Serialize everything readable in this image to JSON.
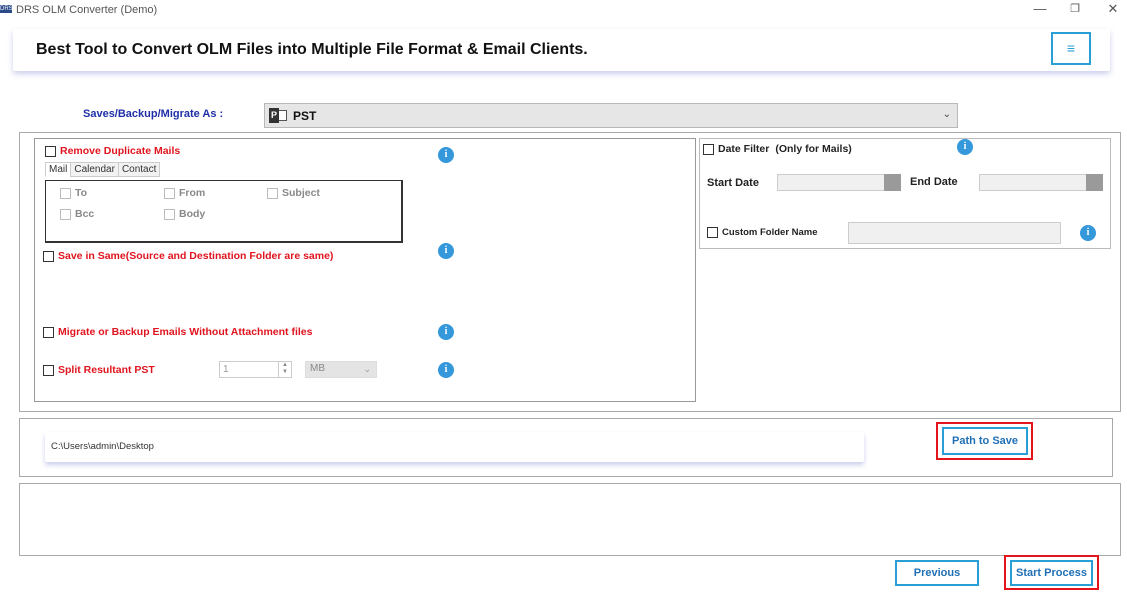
{
  "window": {
    "icon_text": "DRS",
    "title": "DRS OLM Converter (Demo)",
    "controls": {
      "minimize": "—",
      "restore": "❐",
      "close": "✕"
    }
  },
  "banner": {
    "heading": "Best Tool to Convert OLM Files into Multiple File Format & Email Clients.",
    "menu_icon": "≡"
  },
  "format": {
    "label": "Saves/Backup/Migrate As :",
    "icon_letter": "P",
    "selected": "PST",
    "arrow": "⌄"
  },
  "options": {
    "remove_duplicates": "Remove Duplicate Mails",
    "tabs": [
      "Mail",
      "Calendar",
      "Contact"
    ],
    "criteria": {
      "to": "To",
      "from": "From",
      "subject": "Subject",
      "bcc": "Bcc",
      "body": "Body"
    },
    "save_in_same": "Save in Same(Source and Destination Folder are same)",
    "without_attachments": "Migrate or Backup Emails Without Attachment files",
    "split_pst": "Split Resultant PST",
    "split_value": "1",
    "split_unit": "MB",
    "info_symbol": "i"
  },
  "date_filter": {
    "label": "Date Filter",
    "note": "(Only for Mails)",
    "start_label": "Start Date",
    "end_label": "End Date"
  },
  "custom_folder": {
    "label": "Custom Folder Name"
  },
  "path": {
    "value": "C:\\Users\\admin\\Desktop",
    "button": "Path to Save"
  },
  "footer": {
    "previous": "Previous",
    "start": "Start Process"
  },
  "colors": {
    "accent_blue": "#2a9fd6",
    "label_blue": "#1f2fa8",
    "option_red": "#e0141e",
    "highlight_red": "#e3141c",
    "info_blue": "#3498db"
  }
}
